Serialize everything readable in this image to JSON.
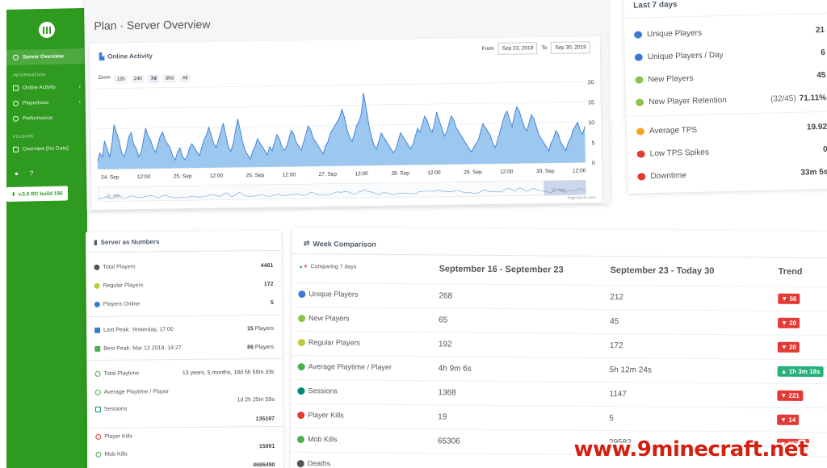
{
  "sidebar": {
    "active_item": "Server Overview",
    "section_information": "INFORMATION",
    "items": [
      {
        "label": "Online Activity",
        "icon": "chart-icon"
      },
      {
        "label": "Playerbase",
        "icon": "users-icon"
      },
      {
        "label": "Performance",
        "icon": "gauge-icon"
      }
    ],
    "section_plugins": "PLUGINS",
    "plugin_item": "Overview (No Data)",
    "version_label": "v.5.0 RC build 196",
    "accent": "#2e9a1f"
  },
  "header": {
    "title": "Plan · Server Overview"
  },
  "online_activity": {
    "title": "Online Activity",
    "from_label": "From",
    "from_date": "Sep 23, 2019",
    "to_label": "To",
    "to_date": "Sep 30, 2019",
    "zoom_label": "Zoom",
    "zoom_buttons": [
      "12h",
      "24h",
      "7d",
      "30d",
      "All"
    ],
    "credit": "Highcharts.com"
  },
  "chart_data": {
    "type": "area",
    "title": "Online Activity",
    "xlabel": "",
    "ylabel": "",
    "ylim": [
      0,
      20
    ],
    "yticks": [
      0,
      5,
      10,
      15,
      20
    ],
    "xticks": [
      "24. Sep",
      "12:00",
      "25. Sep",
      "12:00",
      "26. Sep",
      "12:00",
      "27. Sep",
      "12:00",
      "28. Sep",
      "12:00",
      "29. Sep",
      "12:00",
      "30. Sep",
      "12:00"
    ],
    "navigator_labels": [
      "16. Sep",
      "23. Sep"
    ],
    "series": [
      {
        "values": [
          2,
          4,
          3,
          7,
          5,
          3,
          6,
          11,
          9,
          7,
          4,
          3,
          5,
          8,
          9,
          6,
          5,
          3,
          4,
          7,
          10,
          8,
          7,
          5,
          4,
          6,
          8,
          9,
          7,
          6,
          5,
          3,
          2,
          4,
          5,
          3,
          2,
          3,
          5,
          6,
          5,
          4,
          3,
          5,
          7,
          8,
          10,
          8,
          6,
          5,
          7,
          9,
          11,
          8,
          5,
          4,
          6,
          9,
          12,
          9,
          6,
          4,
          3,
          2,
          4,
          5,
          7,
          6,
          5,
          4,
          3,
          5,
          4,
          6,
          8,
          7,
          5,
          4,
          5,
          7,
          9,
          8,
          6,
          5,
          4,
          6,
          8,
          10,
          9,
          7,
          6,
          5,
          4,
          3,
          5,
          6,
          8,
          9,
          10,
          11,
          12,
          14,
          12,
          9,
          7,
          6,
          8,
          10,
          11,
          13,
          18,
          14,
          10,
          7,
          5,
          4,
          6,
          8,
          7,
          6,
          5,
          4,
          3,
          4,
          6,
          8,
          7,
          6,
          5,
          4,
          5,
          7,
          9,
          8,
          10,
          12,
          11,
          9,
          8,
          10,
          13,
          11,
          9,
          7,
          8,
          10,
          12,
          11,
          9,
          8,
          7,
          6,
          5,
          4,
          3,
          4,
          5,
          6,
          8,
          10,
          9,
          8,
          7,
          5,
          4,
          6,
          8,
          10,
          12,
          13,
          11,
          9,
          12,
          14,
          13,
          11,
          9,
          8,
          10,
          12,
          11,
          9,
          7,
          6,
          5,
          4,
          3,
          5,
          6,
          8,
          7,
          5,
          4,
          3,
          5,
          6,
          8,
          9,
          10,
          8,
          7,
          9
        ]
      }
    ]
  },
  "last7": {
    "title": "Last 7 days",
    "rows": [
      {
        "label": "Unique Players",
        "icon": "users-icon",
        "color": "#3b7bd6",
        "value": "21"
      },
      {
        "label": "Unique Players / Day",
        "icon": "user-icon",
        "color": "#3b7bd6",
        "value": "6"
      },
      {
        "label": "New Players",
        "icon": "users-plus-icon",
        "color": "#8bc34a",
        "value": "45"
      },
      {
        "label": "New Player Retention",
        "icon": "user-circle-icon",
        "color": "#8bc34a",
        "sub": "(32/45)",
        "value": "71.11%"
      },
      {
        "label": "Average TPS",
        "icon": "gauge-icon",
        "color": "#f5a623",
        "value": "19.92"
      },
      {
        "label": "Low TPS Spikes",
        "icon": "alert-icon",
        "color": "#e53935",
        "value": "0"
      },
      {
        "label": "Downtime",
        "icon": "power-icon",
        "color": "#e53935",
        "value": "33m 5s"
      }
    ]
  },
  "numbers": {
    "title": "Server as Numbers",
    "total_players_label": "Total Players",
    "total_players": "4461",
    "regular_players_label": "Regular Players",
    "regular_players": "172",
    "players_online_label": "Players Online",
    "players_online": "5",
    "last_peak_label": "Last Peak: Yesterday, 17:00",
    "last_peak_value": "15",
    "last_peak_unit": "Players",
    "best_peak_label": "Best Peak: Mar 12 2019, 14:27",
    "best_peak_value": "86",
    "best_peak_unit": "Players",
    "total_playtime_label": "Total Playtime",
    "total_playtime": "13 years, 5 months, 18d 5h 59m 33s",
    "avg_playtime_label": "Average Playtime / Player",
    "avg_playtime": "1d 2h 25m 59s",
    "sessions_label": "Sessions",
    "sessions": "135197",
    "player_kills_label": "Player Kills",
    "player_kills": "15991",
    "mob_kills_label": "Mob Kills",
    "mob_kills": "4686490"
  },
  "week": {
    "title": "Week Comparison",
    "header_comparing": "Comparing 7 days",
    "col1": "September 16 - September 23",
    "col2": "September 23 - Today 30",
    "col3": "Trend",
    "rows": [
      {
        "label": "Unique Players",
        "icon": "users-icon",
        "color": "#3b7bd6",
        "a": "268",
        "b": "212",
        "trend": "56",
        "dir": "down"
      },
      {
        "label": "New Players",
        "icon": "users-plus-icon",
        "color": "#8bc34a",
        "a": "65",
        "b": "45",
        "trend": "20",
        "dir": "down"
      },
      {
        "label": "Regular Players",
        "icon": "users-icon",
        "color": "#c0ca33",
        "a": "192",
        "b": "172",
        "trend": "20",
        "dir": "down"
      },
      {
        "label": "Average Playtime / Player",
        "icon": "clock-icon",
        "color": "#4caf50",
        "a": "4h 9m 6s",
        "b": "5h 12m 24s",
        "trend": "1h 3m 18s",
        "dir": "up"
      },
      {
        "label": "Sessions",
        "icon": "calendar-check-icon",
        "color": "#00897b",
        "a": "1368",
        "b": "1147",
        "trend": "221",
        "dir": "down"
      },
      {
        "label": "Player Kills",
        "icon": "crosshairs-icon",
        "color": "#e53935",
        "a": "19",
        "b": "5",
        "trend": "14",
        "dir": "down"
      },
      {
        "label": "Mob Kills",
        "icon": "crosshairs-icon",
        "color": "#4caf50",
        "a": "65306",
        "b": "29582",
        "trend": "35724",
        "dir": "down"
      },
      {
        "label": "Deaths",
        "icon": "skull-icon",
        "color": "#555555",
        "a": "",
        "b": "",
        "trend": "",
        "dir": "down"
      }
    ]
  },
  "watermark": "www.9minecraft.net"
}
